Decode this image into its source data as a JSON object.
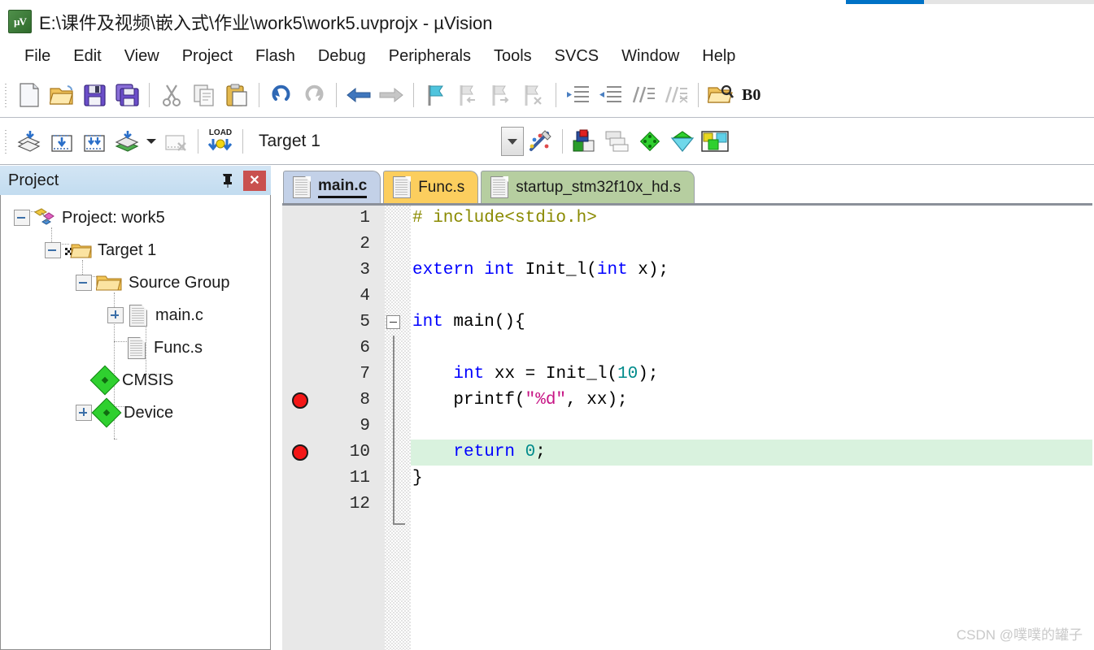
{
  "window": {
    "title": "E:\\课件及视频\\嵌入式\\作业\\work5\\work5.uvprojx - µVision",
    "app_icon": "uvision-logo-icon"
  },
  "menubar": {
    "items": [
      {
        "label": "File"
      },
      {
        "label": "Edit"
      },
      {
        "label": "View"
      },
      {
        "label": "Project"
      },
      {
        "label": "Flash"
      },
      {
        "label": "Debug"
      },
      {
        "label": "Peripherals"
      },
      {
        "label": "Tools"
      },
      {
        "label": "SVCS"
      },
      {
        "label": "Window"
      },
      {
        "label": "Help"
      }
    ]
  },
  "toolbar_file": {
    "buttons": [
      {
        "name": "new-file-icon",
        "tip": "New"
      },
      {
        "name": "open-file-icon",
        "tip": "Open"
      },
      {
        "name": "save-icon",
        "tip": "Save"
      },
      {
        "name": "save-all-icon",
        "tip": "Save All"
      },
      {
        "name": "cut-icon",
        "tip": "Cut"
      },
      {
        "name": "copy-icon",
        "tip": "Copy"
      },
      {
        "name": "paste-icon",
        "tip": "Paste"
      },
      {
        "name": "undo-icon",
        "tip": "Undo"
      },
      {
        "name": "redo-icon",
        "tip": "Redo"
      },
      {
        "name": "navigate-back-icon",
        "tip": "Back"
      },
      {
        "name": "navigate-forward-icon",
        "tip": "Forward"
      },
      {
        "name": "bookmark-toggle-icon",
        "tip": "Insert/Remove Bookmark"
      },
      {
        "name": "bookmark-prev-icon",
        "tip": "Go to Previous Bookmark"
      },
      {
        "name": "bookmark-next-icon",
        "tip": "Go to Next Bookmark"
      },
      {
        "name": "bookmark-clear-icon",
        "tip": "Clear All Bookmarks"
      },
      {
        "name": "indent-icon",
        "tip": "Indent Selected Text"
      },
      {
        "name": "outdent-icon",
        "tip": "Outdent Selected Text"
      },
      {
        "name": "comment-icon",
        "tip": "Comment Selection"
      },
      {
        "name": "uncomment-icon",
        "tip": "Uncomment Selection"
      },
      {
        "name": "find-in-files-icon",
        "tip": "Find in Files"
      }
    ],
    "breakpoint_label": "B0"
  },
  "toolbar_build": {
    "buttons": [
      {
        "name": "translate-icon",
        "tip": "Translate Current File"
      },
      {
        "name": "build-icon",
        "tip": "Build"
      },
      {
        "name": "rebuild-icon",
        "tip": "Rebuild All Target Files"
      },
      {
        "name": "batch-build-icon",
        "tip": "Batch Build"
      },
      {
        "name": "batch-build-dropdown-icon",
        "tip": "Batch Build options"
      },
      {
        "name": "stop-build-icon",
        "tip": "Stop Build"
      },
      {
        "name": "download-icon",
        "tip": "Download"
      }
    ],
    "download_label": "LOAD",
    "target_value": "Target 1",
    "target_dropdown_icon": "chevron-down-icon",
    "right_buttons": [
      {
        "name": "target-options-icon",
        "tip": "Options for Target"
      },
      {
        "name": "project-window-icon",
        "tip": "Project Window"
      },
      {
        "name": "books-window-icon",
        "tip": "Books Window"
      },
      {
        "name": "functions-window-icon",
        "tip": "Functions Window"
      },
      {
        "name": "templates-window-icon",
        "tip": "Templates Window"
      },
      {
        "name": "manage-components-icon",
        "tip": "Manage Run-Time Environment"
      }
    ]
  },
  "project_panel": {
    "title": "Project",
    "pin_icon": "pin-icon",
    "close_icon": "close-icon",
    "tree": [
      {
        "label": "Project: work5",
        "icon": "project-icon",
        "expander": "minus",
        "depth": 0
      },
      {
        "label": "Target 1",
        "icon": "target-folder-icon",
        "expander": "minus",
        "depth": 1
      },
      {
        "label": "Source Group",
        "icon": "folder-icon",
        "expander": "minus",
        "depth": 2
      },
      {
        "label": "main.c",
        "icon": "c-file-icon",
        "expander": "plus",
        "depth": 3
      },
      {
        "label": "Func.s",
        "icon": "asm-file-icon",
        "expander": "none",
        "depth": 3
      },
      {
        "label": "CMSIS",
        "icon": "component-icon",
        "expander": "none",
        "depth": 2
      },
      {
        "label": "Device",
        "icon": "component-icon",
        "expander": "plus",
        "depth": 2
      }
    ]
  },
  "editor": {
    "tabs": [
      {
        "label": "main.c",
        "icon": "file-icon",
        "state": "active"
      },
      {
        "label": "Func.s",
        "icon": "file-icon",
        "state": "orange"
      },
      {
        "label": "startup_stm32f10x_hd.s",
        "icon": "file-icon",
        "state": "green"
      }
    ],
    "lines": [
      {
        "num": "1",
        "breakpoint": false,
        "highlight": false,
        "fold": "none",
        "tokens": [
          {
            "t": "# include<stdio.h>",
            "c": "pp"
          }
        ]
      },
      {
        "num": "2",
        "breakpoint": false,
        "highlight": false,
        "fold": "none",
        "tokens": []
      },
      {
        "num": "3",
        "breakpoint": false,
        "highlight": false,
        "fold": "none",
        "tokens": [
          {
            "t": "extern int",
            "c": "kw"
          },
          {
            "t": " Init_l(",
            "c": "op"
          },
          {
            "t": "int",
            "c": "kw"
          },
          {
            "t": " x);",
            "c": "op"
          }
        ]
      },
      {
        "num": "4",
        "breakpoint": false,
        "highlight": false,
        "fold": "none",
        "tokens": []
      },
      {
        "num": "5",
        "breakpoint": false,
        "highlight": false,
        "fold": "minus",
        "tokens": [
          {
            "t": "int",
            "c": "kw"
          },
          {
            "t": " main(){",
            "c": "op"
          }
        ]
      },
      {
        "num": "6",
        "breakpoint": false,
        "highlight": false,
        "fold": "none",
        "tokens": []
      },
      {
        "num": "7",
        "breakpoint": false,
        "highlight": false,
        "fold": "none",
        "tokens": [
          {
            "t": "    ",
            "c": "op"
          },
          {
            "t": "int",
            "c": "kw"
          },
          {
            "t": " xx = Init_l(",
            "c": "op"
          },
          {
            "t": "10",
            "c": "num"
          },
          {
            "t": ");",
            "c": "op"
          }
        ]
      },
      {
        "num": "8",
        "breakpoint": true,
        "highlight": false,
        "fold": "none",
        "tokens": [
          {
            "t": "    printf(",
            "c": "op"
          },
          {
            "t": "\"%d\"",
            "c": "str"
          },
          {
            "t": ", xx);",
            "c": "op"
          }
        ]
      },
      {
        "num": "9",
        "breakpoint": false,
        "highlight": false,
        "fold": "none",
        "tokens": []
      },
      {
        "num": "10",
        "breakpoint": true,
        "highlight": true,
        "fold": "none",
        "tokens": [
          {
            "t": "    ",
            "c": "op"
          },
          {
            "t": "return",
            "c": "kw"
          },
          {
            "t": " ",
            "c": "op"
          },
          {
            "t": "0",
            "c": "num"
          },
          {
            "t": ";",
            "c": "op"
          }
        ]
      },
      {
        "num": "11",
        "breakpoint": false,
        "highlight": false,
        "fold": "none",
        "tokens": [
          {
            "t": "}",
            "c": "op"
          }
        ]
      },
      {
        "num": "12",
        "breakpoint": false,
        "highlight": false,
        "fold": "none",
        "tokens": []
      }
    ]
  },
  "watermark": {
    "text": "CSDN @噗噗的罐子"
  },
  "colors": {
    "keyword": "#0000ff",
    "preprocessor": "#8a8a00",
    "string": "#c71585",
    "number": "#008b8b",
    "highlight_line": "#d9f2de",
    "breakpoint": "#f41717",
    "tab_active": "#c3d1e8",
    "tab_orange": "#fcce5e",
    "tab_green": "#b6cea0",
    "panel_header": "#c2dcf0",
    "close_button": "#c9514f",
    "accent_blue": "#0072c6"
  }
}
